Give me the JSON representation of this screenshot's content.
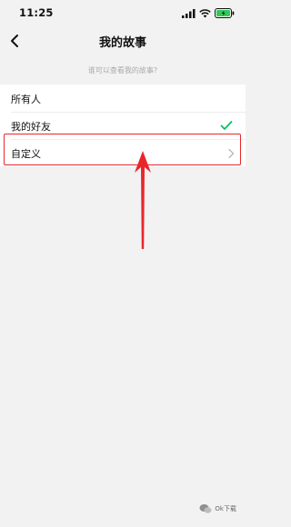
{
  "status_bar": {
    "time": "11:25",
    "icons": [
      "signal-icon",
      "wifi-icon",
      "battery-icon"
    ]
  },
  "nav": {
    "title": "我的故事",
    "back_icon": "chevron-left-icon"
  },
  "hint": "谁可以查看我的故事?",
  "options": [
    {
      "label": "所有人",
      "selected": false
    },
    {
      "label": "我的好友",
      "selected": true,
      "indicator": "check-icon"
    },
    {
      "label": "自定义",
      "selected": false,
      "indicator": "chevron-right-icon"
    }
  ],
  "annotation": {
    "highlight_color": "#e8272b",
    "target": "自定义"
  },
  "watermark": {
    "text": "Ok下载"
  },
  "colors": {
    "background": "#f2f2f2",
    "check": "#07c160",
    "annotation": "#e8272b"
  }
}
